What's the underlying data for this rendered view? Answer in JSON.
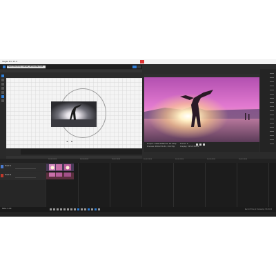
{
  "window": {
    "title": "Vegas Pro 15.0"
  },
  "pan_crop": {
    "title": "Event Pan/Crop: sunset_silhouette.mp4",
    "preset_label": "(Untitled)",
    "controls": [
      "◄",
      "►"
    ]
  },
  "preview": {
    "project": "Project: 1920x1080x32, 29.970p",
    "preview": "Preview: 480x270x32, 29.970p",
    "display": "Display: 597x336x32",
    "frame": "Frame: 0"
  },
  "tracks": [
    {
      "name": "Track 1",
      "type": "video",
      "color": "#4a7bd1"
    },
    {
      "name": "Track 2",
      "type": "audio",
      "color": "#c0392b"
    }
  ],
  "status": {
    "rate": "Rate: 0.00",
    "info": "Record Time (2 channels): 33:43:15"
  },
  "timecodes": [
    "00:00:00;00",
    "00:00:05;00",
    "00:00:10;00",
    "00:00:15;00",
    "00:00:20;00",
    "00:00:25;00",
    "00:00:30;00"
  ],
  "colors": {
    "accent": "#2f7fd8",
    "track_video": "#4a7bd1",
    "track_audio": "#c0392b"
  }
}
